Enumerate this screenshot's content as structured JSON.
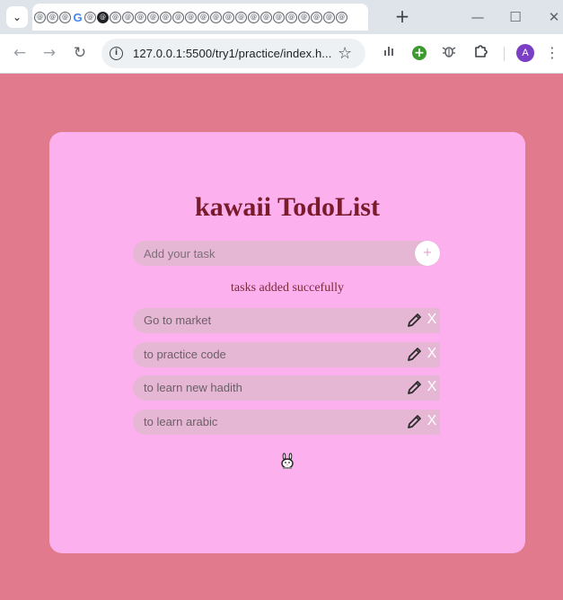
{
  "browser": {
    "tab_menu_icon": "chevron-down-icon",
    "new_tab_icon": "plus-icon",
    "window_controls": {
      "minimize": "—",
      "maximize": "☐",
      "close": "✕"
    },
    "back_icon": "arrow-left-icon",
    "forward_icon": "arrow-right-icon",
    "reload_icon": "reload-icon",
    "url": "127.0.0.1:5500/try1/practice/index.h...",
    "bookmark_icon": "star-icon",
    "extensions": [
      "bar-chart-icon",
      "plus-circle-icon",
      "bug-icon",
      "puzzle-icon"
    ],
    "profile_initial": "A",
    "menu_icon": "kebab-menu-icon"
  },
  "app": {
    "title": "kawaii TodoList",
    "input_placeholder": "Add your task",
    "add_button_label": "+",
    "status_message": "tasks added succefully",
    "delete_label": "X",
    "tasks": [
      {
        "text": "Go to market"
      },
      {
        "text": "to practice code"
      },
      {
        "text": "to learn new hadith"
      },
      {
        "text": "to learn arabic"
      }
    ],
    "footer_icon": "bunny-icon"
  },
  "colors": {
    "page_background": "#e07a8c",
    "card_background": "#fdb0ee",
    "row_background": "#e6b7d4",
    "title_color": "#7a1b2c"
  }
}
